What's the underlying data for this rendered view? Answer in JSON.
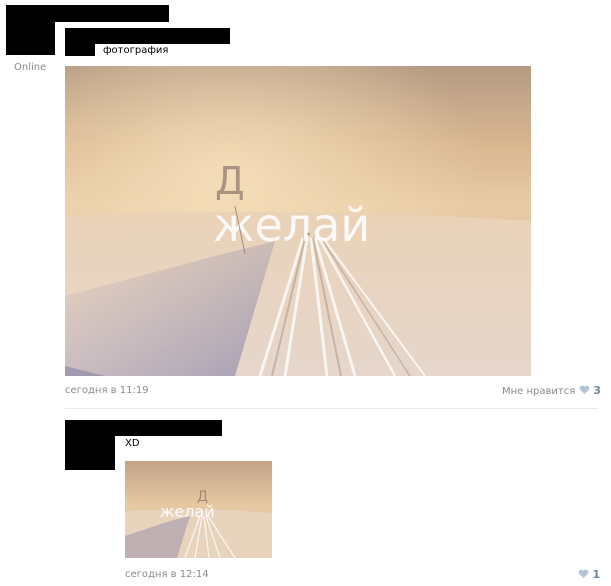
{
  "post": {
    "status": "Online",
    "caption": "фотография",
    "image": {
      "word_top": "Д",
      "word_main": "желай",
      "alt_desc": "snowy road with ski tracks at sunset"
    },
    "timestamp": "сегодня в 11:19",
    "likes_label": "Мне нравится",
    "likes_count": "3"
  },
  "reply": {
    "text": "XD",
    "image": {
      "word_top": "Д",
      "word_main": "желай"
    },
    "timestamp": "сегодня в 12:14",
    "likes_count": "1"
  },
  "colors": {
    "meta_gray": "#8a8a8a",
    "like_blue": "#6f86a3",
    "divider": "#e7e7e7"
  }
}
